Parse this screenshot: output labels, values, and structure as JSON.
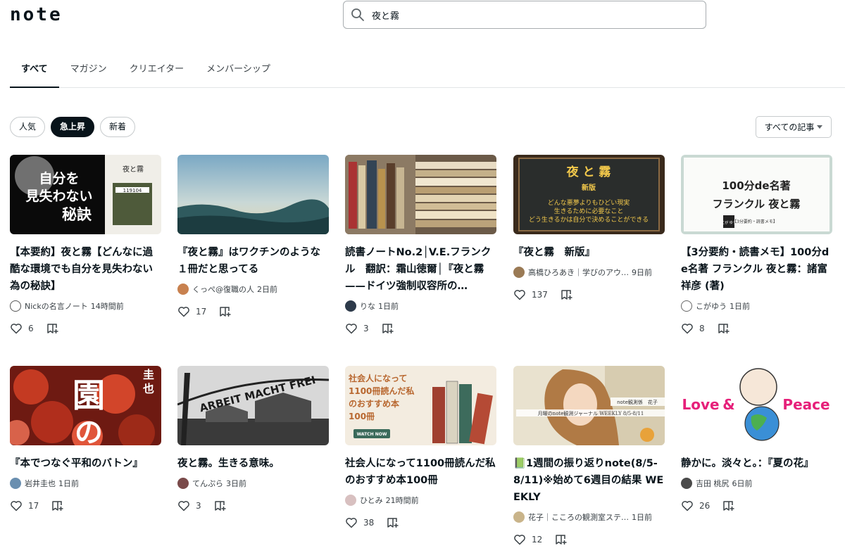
{
  "logo": "note",
  "search": {
    "value": "夜と霧"
  },
  "tabs": [
    "すべて",
    "マガジン",
    "クリエイター",
    "メンバーシップ"
  ],
  "filters": [
    "人気",
    "急上昇",
    "新着"
  ],
  "sort": {
    "label": "すべての記事"
  },
  "cards": [
    {
      "title": "【本要約】夜と霧【どんなに過酷な環境でも自分を見失わない為の秘訣】",
      "creator": "Nickの名言ノート",
      "time": "14時間前",
      "likes": "6",
      "thumb_text": [
        "自分を",
        "見失わない",
        "秘訣"
      ],
      "thumb_side": [
        "夜と霧",
        "119104"
      ]
    },
    {
      "title": "『夜と霧』はワクチンのような１冊だと思ってる",
      "creator": "くっぺ@復職の人",
      "time": "2日前",
      "likes": "17"
    },
    {
      "title": "読書ノートNo.2│V.E.フランクル　翻訳：霜山徳爾│『夜と霧——ドイツ強制収容所の…",
      "creator": "りな",
      "time": "1日前",
      "likes": "3"
    },
    {
      "title": "『夜と霧　新版』",
      "creator": "高橋ひろあき｜学びのアウ…",
      "time": "9日前",
      "likes": "137",
      "thumb_text": [
        "夜 と 霧",
        "新版",
        "どんな悪夢よりもひどい現実",
        "生きるために必要なこと",
        "どう生きるかは自分で決めることができる"
      ]
    },
    {
      "title": "【3分要約・読書メモ】100分de名著 フランクル 夜と霧：諸富祥彦 (著)",
      "creator": "こがゆう",
      "time": "1日前",
      "likes": "8",
      "thumb_text": [
        "100分de名著",
        "フランクル 夜と霧",
        "こが ゆう",
        "【3分要約・読書メモ】"
      ]
    },
    {
      "title": "『本でつなぐ平和のバトン』",
      "creator": "岩井圭也",
      "time": "1日前",
      "likes": "17",
      "thumb_text": [
        "園",
        "の",
        "圭",
        "也"
      ]
    },
    {
      "title": "夜と霧。生きる意味。",
      "creator": "てんぷら",
      "time": "3日前",
      "likes": "3",
      "thumb_text": [
        "ARBEIT MACHT FREI"
      ]
    },
    {
      "title": "社会人になって1100冊読んだ私のおすすめ本100冊",
      "creator": "ひとみ",
      "time": "21時間前",
      "likes": "38",
      "thumb_text": [
        "社会人になって",
        "1100冊読んだ私",
        "のおすすめ本",
        "100冊",
        "WATCH NOW"
      ]
    },
    {
      "title": "📗1週間の振り返りnote(8/5-8/11)※始めて6週目の結果 WEEKLY",
      "creator": "花子｜こころの観測室ステ…",
      "time": "1日前",
      "likes": "12",
      "thumb_text": [
        "note観測係　花子",
        "月曜のnote観測ジャーナル WEEKLY 8/5-8/11"
      ]
    },
    {
      "title": "静かに。淡々と。：『夏の花』",
      "creator": "吉田 桃尻",
      "time": "6日前",
      "likes": "26",
      "thumb_text": [
        "Love",
        "&",
        "Peace"
      ]
    }
  ]
}
